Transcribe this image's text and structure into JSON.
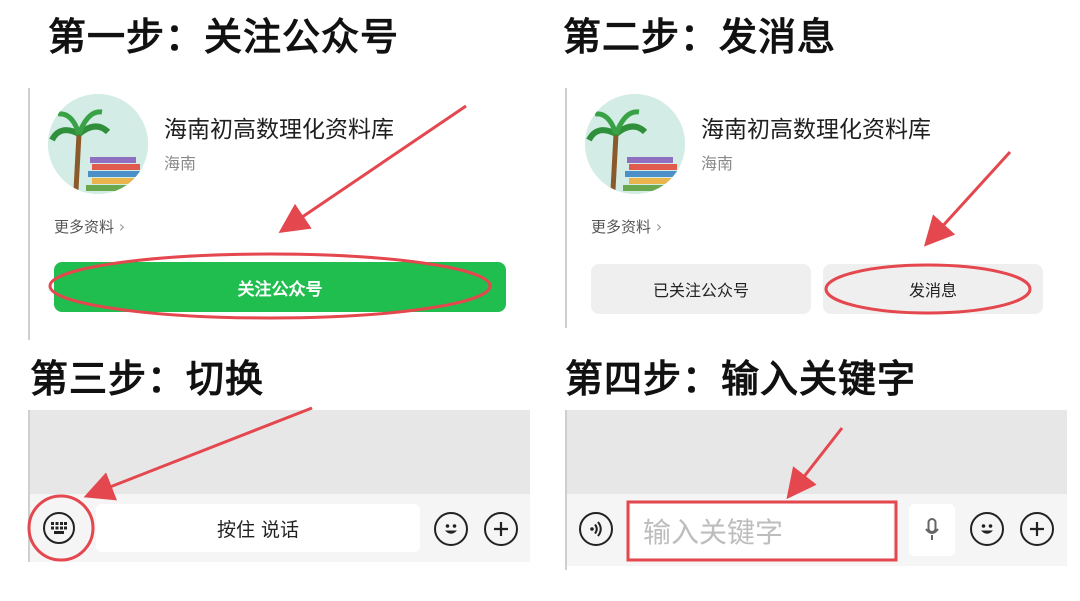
{
  "steps": {
    "step1": {
      "title": "第一步：关注公众号"
    },
    "step2": {
      "title": "第二步：发消息"
    },
    "step3": {
      "title": "第三步：切换"
    },
    "step4": {
      "title": "第四步：输入关键字"
    }
  },
  "account": {
    "name": "海南初高数理化资料库",
    "region": "海南",
    "more_label": "更多资料",
    "chevron": "›",
    "avatar_text": [
      "海南初高数理化",
      "资料库"
    ]
  },
  "buttons": {
    "follow_label": "关注公众号",
    "followed_label": "已关注公众号",
    "message_label": "发消息"
  },
  "chat": {
    "hold_to_talk": "按住 说话",
    "input_placeholder": "输入关键字"
  },
  "colors": {
    "accent_green": "#1fbe4f",
    "highlight_red": "#e4474e"
  },
  "icons": [
    "keyboard-icon",
    "emoji-icon",
    "plus-icon",
    "voice-icon",
    "mic-icon",
    "chevron-right-icon"
  ]
}
